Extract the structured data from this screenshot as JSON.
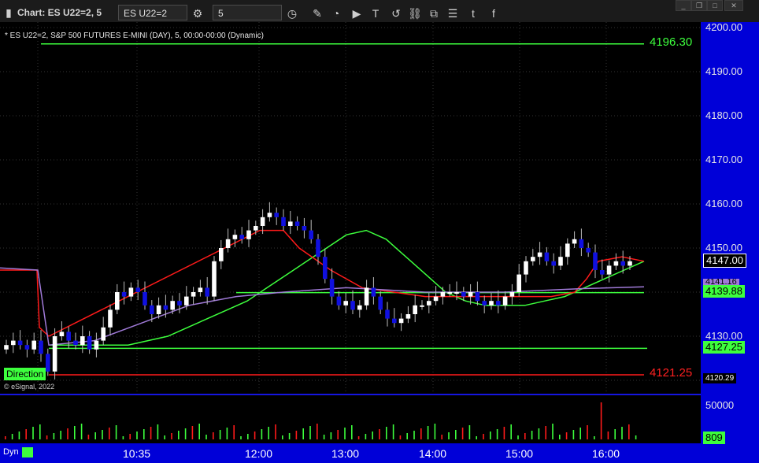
{
  "window": {
    "title": "Chart: ES U22=2, 5",
    "symbol_value": "ES U22=2",
    "interval_value": "5",
    "controls": [
      "minimize-icon",
      "restore-icon",
      "maximize-icon",
      "close-icon"
    ]
  },
  "toolbar_icons": [
    "draw-icon",
    "chart-style-icon",
    "play-icon",
    "text-icon",
    "reset-icon",
    "link-icon",
    "copy-icon",
    "comment-icon",
    "twitter-icon",
    "facebook-icon"
  ],
  "chart": {
    "header": "* ES U22=2, S&P 500 FUTURES E-MINI (DAY), 5, 00:00-00:00 (Dynamic)",
    "copyright": "© eSignal, 2022",
    "direction_label": "Direction",
    "dyn_label": "Dyn",
    "y_ticks": [
      "4200.00",
      "4190.00",
      "4180.00",
      "4170.00",
      "4160.00",
      "4150.00",
      "4130.00"
    ],
    "x_ticks": [
      "10:35",
      "12:00",
      "13:00",
      "14:00",
      "15:00",
      "16:00"
    ],
    "levels": {
      "top_green": "4196.30",
      "bottom_red": "4121.25",
      "green_1": "4139.88",
      "green_2": "4127.25",
      "current": "4147.00",
      "purple": "4141.16",
      "low_tag": "4120.29"
    },
    "volume_ticks": [
      "50000",
      "809"
    ],
    "colors": {
      "up_candle": "#ffffff",
      "down_candle": "#1010e0",
      "green_line": "#3dff3d",
      "red_line": "#ff1a1a",
      "purple_line": "#a07ad8",
      "axis_bg": "#0000d8"
    }
  },
  "chart_data": {
    "type": "line",
    "candles_close": [
      4128,
      4129,
      4128,
      4127,
      4129,
      4126,
      4122,
      4130,
      4131,
      4129,
      4128,
      4130,
      4127,
      4129,
      4132,
      4136,
      4140,
      4139,
      4141,
      4140,
      4137,
      4135,
      4137,
      4136,
      4138,
      4137,
      4139,
      4140,
      4141,
      4139,
      4147,
      4150,
      4152,
      4153,
      4152,
      4154,
      4155,
      4157,
      4158,
      4157,
      4155,
      4156,
      4155,
      4154,
      4152,
      4148,
      4143,
      4139,
      4137,
      4138,
      4136,
      4137,
      4141,
      4139,
      4136,
      4134,
      4133,
      4134,
      4135,
      4137,
      4137,
      4138,
      4139,
      4140,
      4140,
      4140,
      4139,
      4140,
      4138,
      4137,
      4138,
      4137,
      4139,
      4140,
      4144,
      4147,
      4148,
      4149,
      4147,
      4146,
      4148,
      4151,
      4152,
      4150,
      4149,
      4145,
      4144,
      4146,
      4147,
      4146,
      4147
    ],
    "series": [
      {
        "name": "green",
        "values": [
          4128,
          4128,
          4128,
          4128,
          4128,
          4129,
          4130,
          4132,
          4134,
          4136,
          4138,
          4141,
          4144,
          4147,
          4150,
          4153,
          4154,
          4152,
          4148,
          4144,
          4140,
          4138,
          4137,
          4137,
          4137,
          4138,
          4139,
          4141,
          4143,
          4145,
          4147
        ]
      },
      {
        "name": "red",
        "values": [
          4145,
          4145,
          4145,
          4132,
          4130,
          4154,
          4154,
          4150,
          4145,
          4141,
          4140,
          4139,
          4139,
          4139,
          4139,
          4139,
          4140,
          4143,
          4147,
          4148,
          4147
        ]
      }
    ],
    "ylim": [
      4115,
      4205
    ]
  }
}
